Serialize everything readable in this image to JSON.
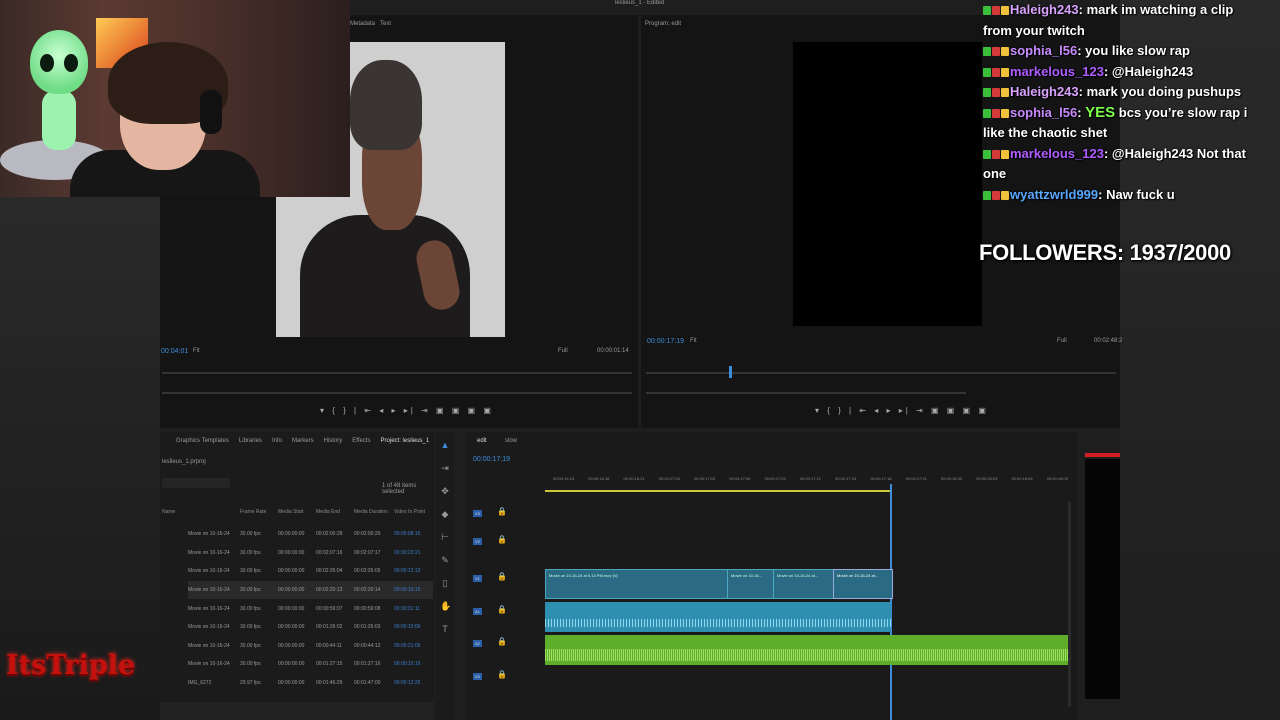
{
  "chat": {
    "messages": [
      {
        "user": "Haleigh243",
        "user_color": "#d9a4ff",
        "text": ": mark im watching a clip from your twitch"
      },
      {
        "user": "sophia_l56",
        "user_color": "#c98cff",
        "text": ": you like slow rap"
      },
      {
        "user": "markelous_123",
        "user_color": "#b05cff",
        "text": ": @Haleigh243"
      },
      {
        "user": "Haleigh243",
        "user_color": "#d9a4ff",
        "text": ": mark you doing pushups"
      },
      {
        "user": "sophia_l56",
        "user_color": "#c98cff",
        "highlight": "YES",
        "text": " bcs you’re slow rap i like the chaotic shet"
      },
      {
        "user": "markelous_123",
        "user_color": "#b05cff",
        "text": ": @Haleigh243 Not that one"
      },
      {
        "user": "wyattzwrld999",
        "user_color": "#59a8ff",
        "text": ": Naw fuck u"
      }
    ]
  },
  "followers": {
    "label": "FOLLOWERS: 1937/2000",
    "current": 1937,
    "goal": 2000
  },
  "logo": {
    "text": "ItsTriple"
  },
  "app": {
    "window_title": "leslieus_1 - Edited",
    "source_tabs": [
      "Metadata",
      "Text"
    ],
    "program_tab": "Program: edit",
    "source_timecode": "00:04:01",
    "source_fit": "Fit",
    "source_full": "Full",
    "source_duration": "00:00:01:14",
    "program_timecode": "00:00:17:19",
    "program_fit": "Fit",
    "program_full": "Full",
    "program_duration": "00:02:48:2",
    "transport_source": "▾ { } | ⇤ ◂ ▸ ▸| ⇥ ▣ ▣ ▣ ▣",
    "transport_program": "▾ { } | ⇤ ◂ ▸ ▸| ⇥ ▣ ▣ ▣ ▣",
    "project_tabs": [
      "Graphics Templates",
      "Libraries",
      "Info",
      "Markers",
      "History",
      "Effects",
      "Project: leslieus_1"
    ],
    "project_file": "leslieus_1.prproj",
    "items_selected": "1 of 48 items selected",
    "columns": [
      "Name",
      "Frame Rate",
      "Media Start",
      "Media End",
      "Media Duration",
      "Video In Point"
    ],
    "rows": [
      [
        "Movie on 10-16-24",
        "30.00 fps",
        "00:00:00:00",
        "00:02:00:28",
        "00:02:00:29",
        "00:00:08:16"
      ],
      [
        "Movie on 10-16-24",
        "30.00 fps",
        "00:00:00:00",
        "00:02:07:16",
        "00:02:07:17",
        "00:00:23:21"
      ],
      [
        "Movie on 10-16-24",
        "30.00 fps",
        "00:00:00:00",
        "00:02:26:04",
        "00:02:26:05",
        "00:00:12:13"
      ],
      [
        "Movie on 10-16-24",
        "30.00 fps",
        "00:00:00:00",
        "00:02:20:13",
        "00:02:20:14",
        "00:00:10:15"
      ],
      [
        "Movie on 10-16-24",
        "30.00 fps",
        "00:00:00:00",
        "00:00:59:07",
        "00:00:59:08",
        "00:00:31:11"
      ],
      [
        "Movie on 10-16-24",
        "30.00 fps",
        "00:00:00:00",
        "00:01:26:02",
        "00:01:26:03",
        "00:00:10:09"
      ],
      [
        "Movie on 10-16-24",
        "30.00 fps",
        "00:00:00:00",
        "00:00:44:11",
        "00:00:44:12",
        "00:00:21:05"
      ],
      [
        "Movie on 10-16-24",
        "30.00 fps",
        "00:00:00:00",
        "00:01:27:15",
        "00:01:27:16",
        "00:00:10:16"
      ],
      [
        "IMG_6272",
        "29.97 fps",
        "00:00:00:00",
        "00:01:46:29",
        "00:01:47:00",
        "00:00:12:25"
      ]
    ],
    "timeline_tabs": [
      "edit",
      "slow"
    ],
    "timeline_timecode": "00:00:17:19",
    "ruler": [
      "00:00:14:15",
      "00:00:16:18",
      "00:00:16:21",
      "00:00:17:00",
      "00:00:17:03",
      "00:00:17:06",
      "00:00:17:09",
      "00:00:17:12",
      "00:00:17:15",
      "00:00:17:18",
      "00:00:17:21",
      "00:00:18:00",
      "00:00:18:03",
      "00:00:18:06",
      "00:00:18:09"
    ],
    "tracks": [
      "V3",
      "V2",
      "V1",
      "A1",
      "A2",
      "A3"
    ],
    "clips": [
      "Movie on 10-16-24 at 5.13 PM.mov [V]",
      "Movie on 10-16...",
      "Movie on 10-16-24 at...",
      "Movie on 10-16-24 at..."
    ]
  },
  "colors": {
    "accent_blue": "#3d8bd9",
    "clip_video": "#2a6a82",
    "clip_audio": "#2e8fb0",
    "clip_green": "#5fae2b",
    "logo_red": "#c4110d",
    "highlight_green": "#7cff4a"
  }
}
